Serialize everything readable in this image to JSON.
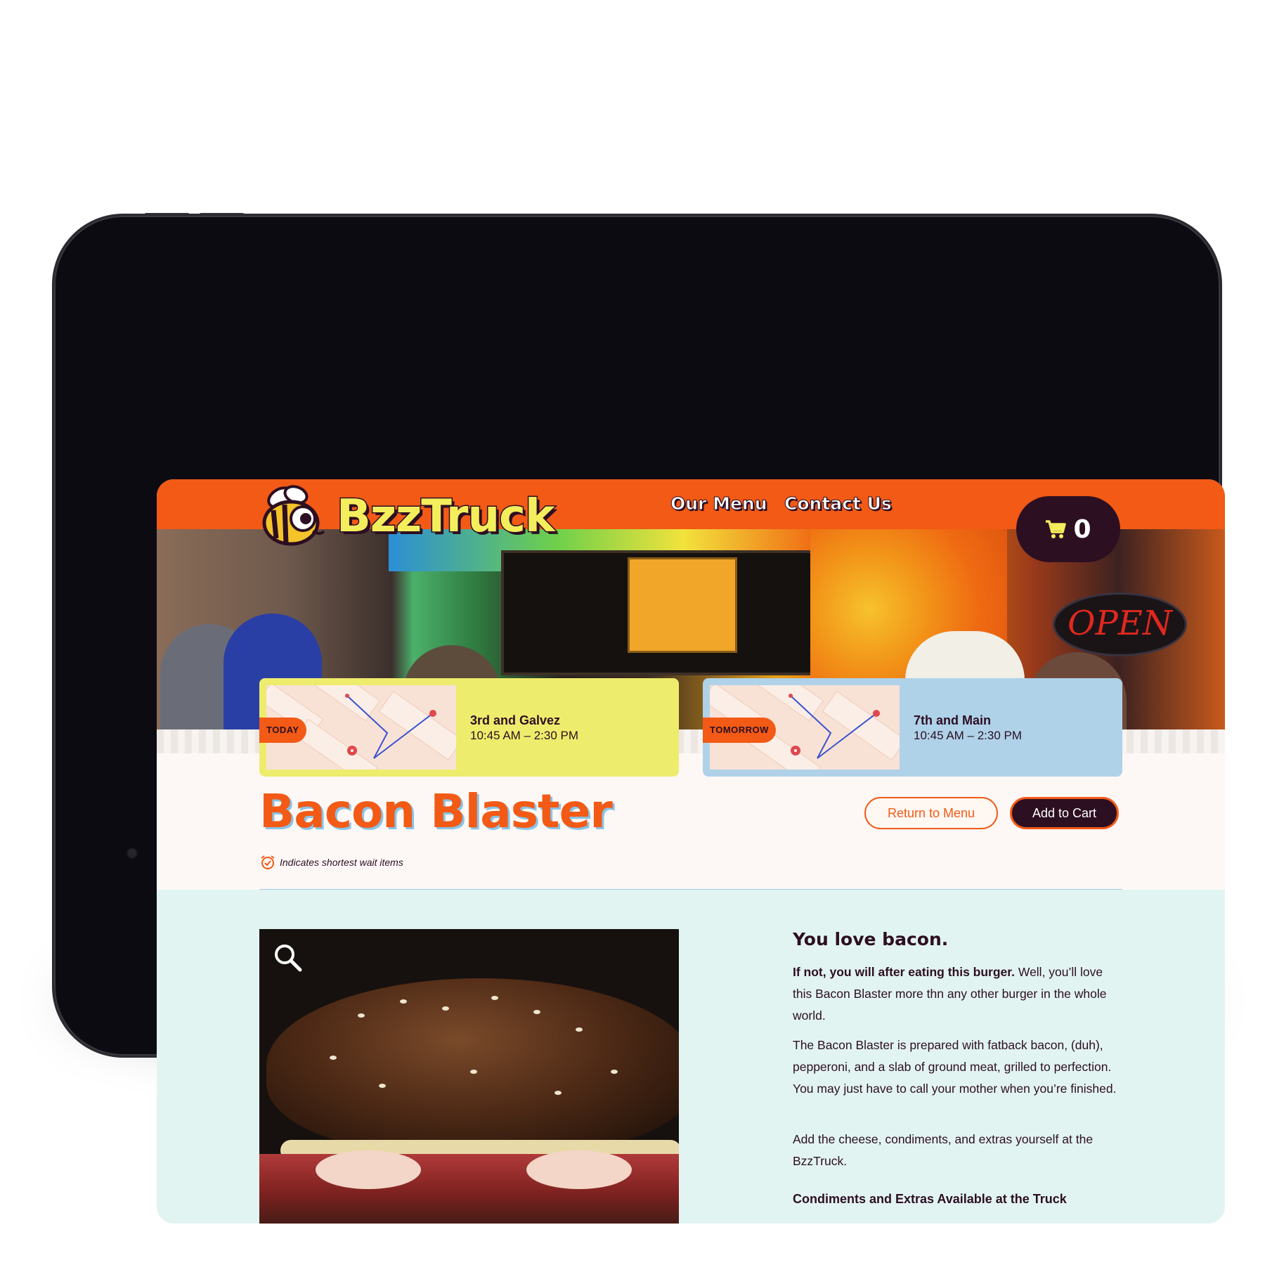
{
  "header": {
    "brand": "BzzTruck",
    "nav": [
      {
        "label": "Our Menu"
      },
      {
        "label": "Contact Us"
      }
    ],
    "cart_count": "0"
  },
  "hero": {
    "sign_text": "OPEN"
  },
  "schedule": [
    {
      "day": "TODAY",
      "location": "3rd and Galvez",
      "hours": "10:45 AM – 2:30 PM",
      "color": "#eeec6c"
    },
    {
      "day": "TOMORROW",
      "location": "7th and Main",
      "hours": "10:45 AM – 2:30 PM",
      "color": "#afd2e9"
    }
  ],
  "product": {
    "name": "Bacon Blaster",
    "return_label": "Return to Menu",
    "add_label": "Add to Cart",
    "legend": "Indicates shortest wait items"
  },
  "description": {
    "heading": "You love bacon.",
    "p1_bold": "If not, you will after eating this burger.",
    "p1_rest": " Well, you’ll love this Bacon Blaster more thn any other burger in the whole world.",
    "p2": "The Bacon Blaster is prepared with fatback bacon, (duh), pepperoni, and a slab of ground meat, grilled to perfection. You may just have to call your mother when you’re finished.",
    "p3": "Add the cheese, condiments, and extras yourself at the BzzTruck.",
    "extras_heading": "Condiments and Extras Available at the Truck"
  },
  "colors": {
    "brand_orange": "#f25a16",
    "brand_dark": "#2d0f22",
    "brand_yellow": "#f4ee5c",
    "accent_blue": "#8ac3e6",
    "lower_bg": "#e2f4f2"
  }
}
